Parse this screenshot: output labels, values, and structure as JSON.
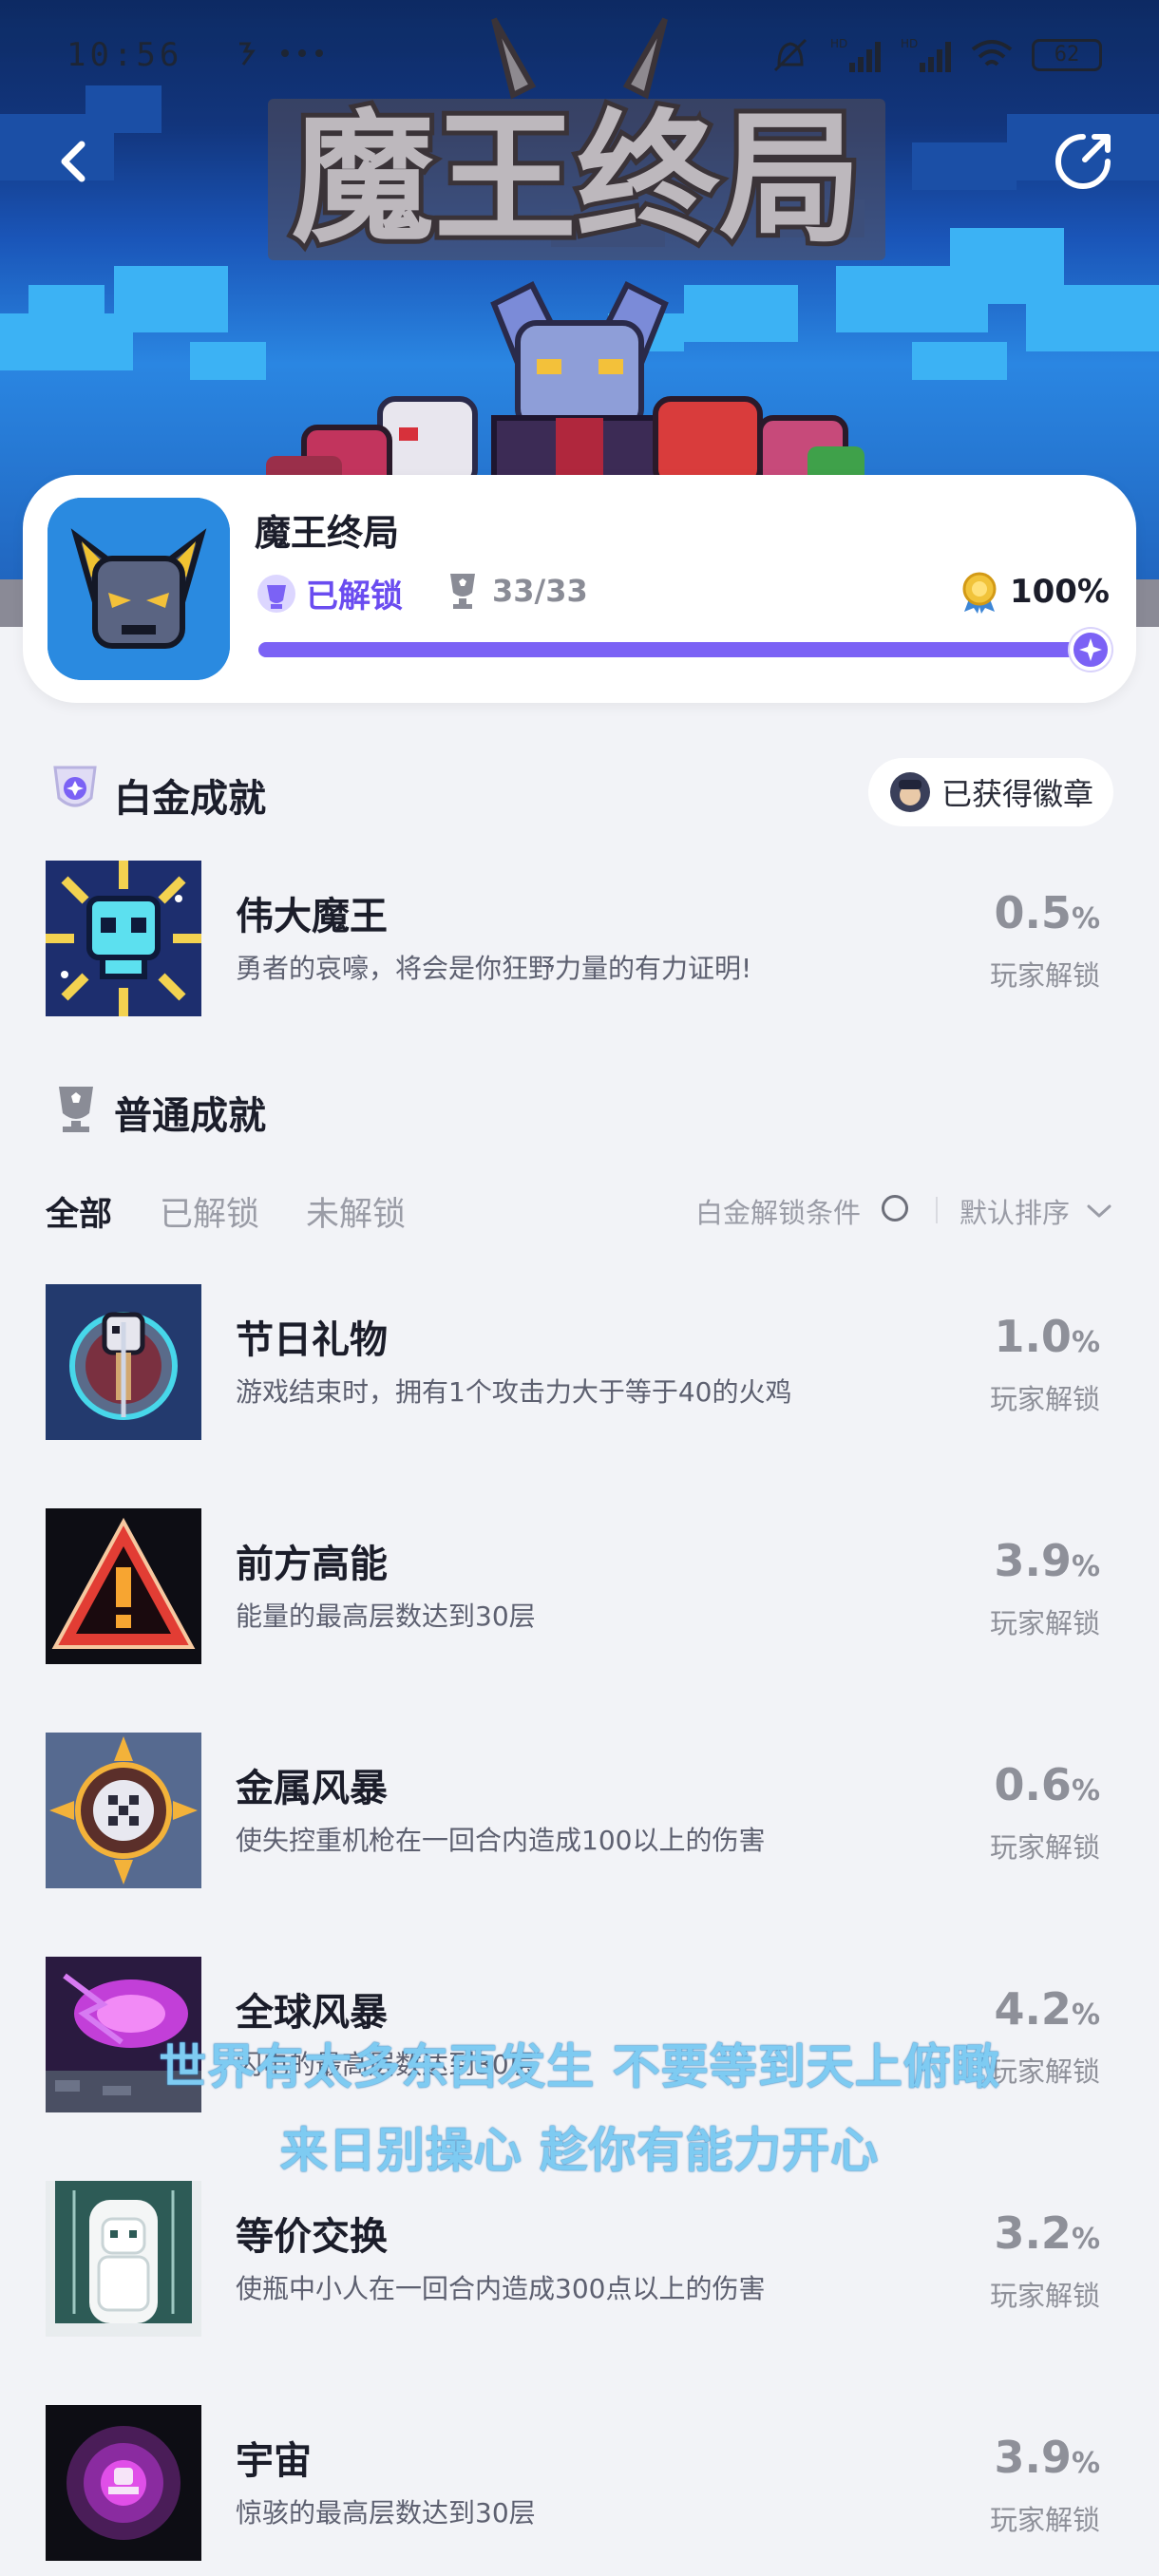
{
  "status_bar": {
    "time": "10:56",
    "extras": "☃ ···",
    "battery": "62"
  },
  "hero": {
    "art_title": "魔王终局"
  },
  "game": {
    "title": "魔王终局",
    "unlock_status": "已解锁",
    "trophies": "33/33",
    "completion": "100%",
    "progress": 1.0
  },
  "platinum": {
    "section_title": "白金成就",
    "badge_button": "已获得徽章",
    "achievement": {
      "name": "伟大魔王",
      "desc": "勇者的哀嚎，将会是你狂野力量的有力证明!",
      "pct": "0.5",
      "pct_unit": "%",
      "sub": "玩家解锁",
      "icon": "skull-icon"
    }
  },
  "normal": {
    "section_title": "普通成就",
    "tabs": [
      "全部",
      "已解锁",
      "未解锁"
    ],
    "condition_label": "白金解锁条件",
    "sort_label": "默认排序",
    "achievements": [
      {
        "name": "节日礼物",
        "desc": "游戏结束时，拥有1个攻击力大于等于40的火鸡",
        "pct": "1.0",
        "unit": "%",
        "sub": "玩家解锁",
        "icon": "turkey-icon"
      },
      {
        "name": "前方高能",
        "desc": "能量的最高层数达到30层",
        "pct": "3.9",
        "unit": "%",
        "sub": "玩家解锁",
        "icon": "warning-icon"
      },
      {
        "name": "金属风暴",
        "desc": "使失控重机枪在一回合内造成100以上的伤害",
        "pct": "0.6",
        "unit": "%",
        "sub": "玩家解锁",
        "icon": "gear-icon"
      },
      {
        "name": "全球风暴",
        "desc": "闪电的最高层数达到30层",
        "pct": "4.2",
        "unit": "%",
        "sub": "玩家解锁",
        "icon": "storm-icon"
      },
      {
        "name": "等价交换",
        "desc": "使瓶中小人在一回合内造成300点以上的伤害",
        "pct": "3.2",
        "unit": "%",
        "sub": "玩家解锁",
        "icon": "bottle-icon"
      },
      {
        "name": "宇宙",
        "desc": "惊骇的最高层数达到30层",
        "pct": "3.9",
        "unit": "%",
        "sub": "玩家解锁",
        "icon": "cosmos-icon"
      }
    ]
  },
  "lyrics": {
    "line1": "世界有太多东西发生 不要等到天上俯瞰",
    "line2": "来日别操心 趁你有能力开心"
  },
  "colors": {
    "accent": "#7b62f5",
    "text_dark": "#1b1d2a",
    "text_muted": "#8e9099",
    "lyric": "#7ecbf2"
  }
}
